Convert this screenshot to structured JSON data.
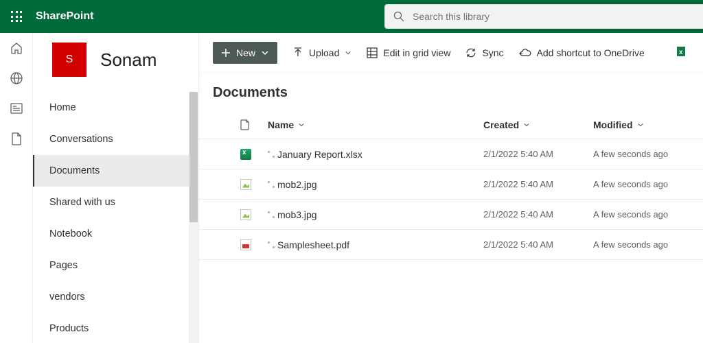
{
  "suite": {
    "brand": "SharePoint"
  },
  "search": {
    "placeholder": "Search this library"
  },
  "site": {
    "initial": "S",
    "name": "Sonam"
  },
  "nav": {
    "items": [
      {
        "label": "Home"
      },
      {
        "label": "Conversations"
      },
      {
        "label": "Documents"
      },
      {
        "label": "Shared with us"
      },
      {
        "label": "Notebook"
      },
      {
        "label": "Pages"
      },
      {
        "label": "vendors"
      },
      {
        "label": "Products"
      }
    ]
  },
  "toolbar": {
    "new": "New",
    "upload": "Upload",
    "gridview": "Edit in grid view",
    "sync": "Sync",
    "shortcut": "Add shortcut to OneDrive"
  },
  "list": {
    "title": "Documents",
    "headers": {
      "name": "Name",
      "created": "Created",
      "modified": "Modified"
    },
    "rows": [
      {
        "type": "xlsx",
        "name": "January Report.xlsx",
        "created": "2/1/2022 5:40 AM",
        "modified": "A few seconds ago"
      },
      {
        "type": "jpg",
        "name": "mob2.jpg",
        "created": "2/1/2022 5:40 AM",
        "modified": "A few seconds ago"
      },
      {
        "type": "jpg",
        "name": "mob3.jpg",
        "created": "2/1/2022 5:40 AM",
        "modified": "A few seconds ago"
      },
      {
        "type": "pdf",
        "name": "Samplesheet.pdf",
        "created": "2/1/2022 5:40 AM",
        "modified": "A few seconds ago"
      }
    ]
  }
}
